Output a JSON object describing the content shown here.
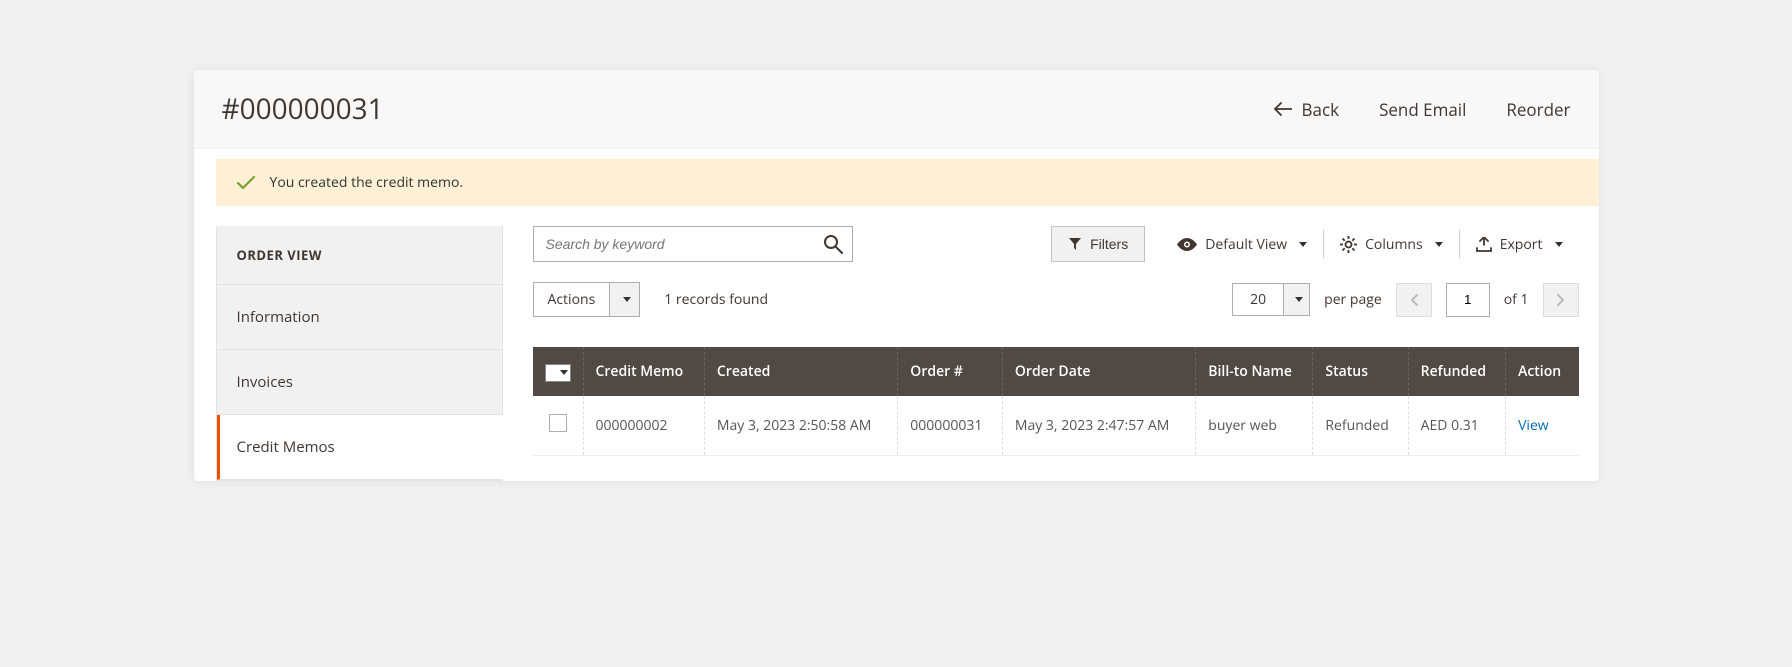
{
  "header": {
    "title": "#000000031",
    "back_label": "Back",
    "send_email_label": "Send Email",
    "reorder_label": "Reorder"
  },
  "message": {
    "text": "You created the credit memo."
  },
  "sidebar": {
    "title": "ORDER VIEW",
    "items": [
      {
        "label": "Information",
        "active": false
      },
      {
        "label": "Invoices",
        "active": false
      },
      {
        "label": "Credit Memos",
        "active": true
      }
    ]
  },
  "toolbar": {
    "search_placeholder": "Search by keyword",
    "filters_label": "Filters",
    "default_view_label": "Default View",
    "columns_label": "Columns",
    "export_label": "Export",
    "actions_label": "Actions",
    "records_found": "1 records found",
    "per_page_value": "20",
    "per_page_label": "per page",
    "page_value": "1",
    "page_of": "of 1"
  },
  "grid": {
    "headers": {
      "credit_memo": "Credit Memo",
      "created": "Created",
      "order_no": "Order #",
      "order_date": "Order Date",
      "bill_to": "Bill-to Name",
      "status": "Status",
      "refunded": "Refunded",
      "action": "Action"
    },
    "rows": [
      {
        "credit_memo": "000000002",
        "created": "May 3, 2023 2:50:58 AM",
        "order_no": "000000031",
        "order_date": "May 3, 2023 2:47:57 AM",
        "bill_to": "buyer web",
        "status": "Refunded",
        "refunded": "AED 0.31",
        "action": "View"
      }
    ]
  }
}
